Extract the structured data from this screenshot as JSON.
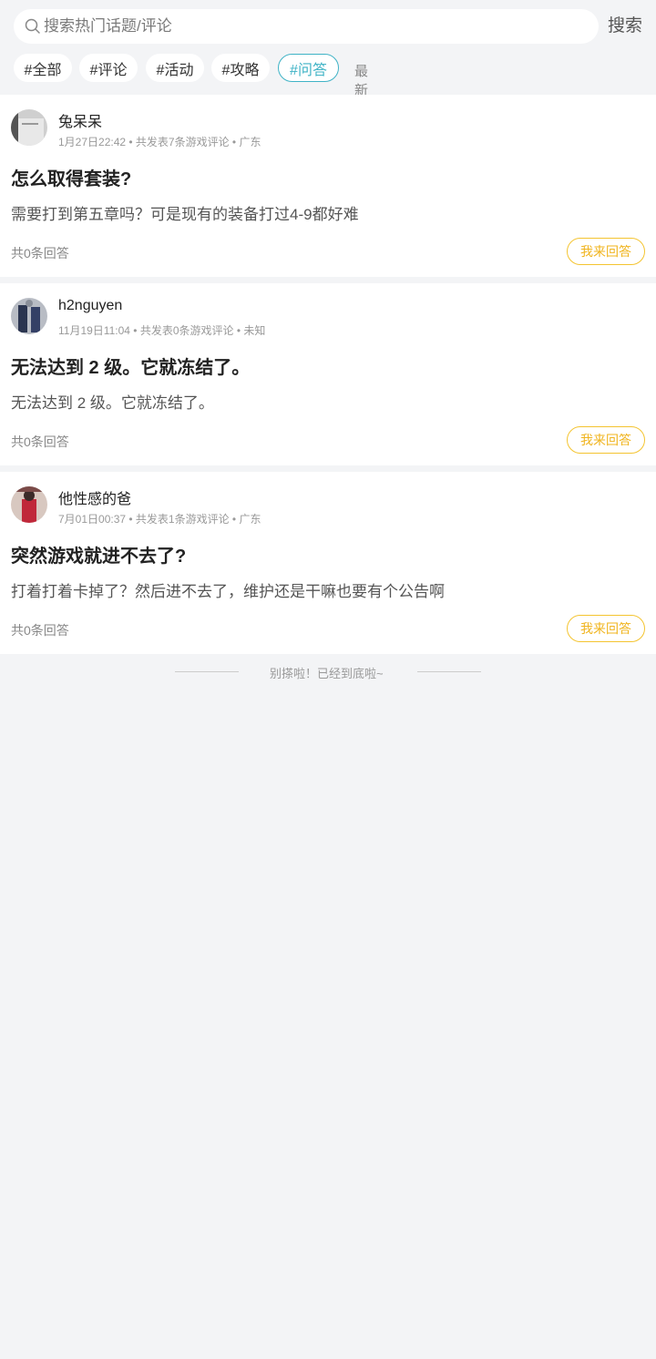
{
  "search": {
    "placeholder": "搜索热门话题/评论",
    "button_label": "搜索"
  },
  "tags": [
    {
      "label": "#全部",
      "active": false
    },
    {
      "label": "#评论",
      "active": false
    },
    {
      "label": "#活动",
      "active": false
    },
    {
      "label": "#攻略",
      "active": false
    },
    {
      "label": "#问答",
      "active": true
    }
  ],
  "sort": {
    "label": "最新帖子",
    "icon": "sort-arrows-icon"
  },
  "posts": [
    {
      "username": "兔呆呆",
      "meta": "1月27日22:42 • 共发表7条游戏评论 • 广东",
      "title": "怎么取得套装?",
      "content": "需要打到第五章吗？可是现有的装备打过4-9都好难",
      "answer_count": "共0条回答",
      "answer_label": "我来回答"
    },
    {
      "username": "h2nguyen",
      "meta": "11月19日11:04 • 共发表0条游戏评论 • 未知",
      "title": "无法达到 2 级。它就冻结了。",
      "content": "无法达到 2 级。它就冻结了。",
      "answer_count": "共0条回答",
      "answer_label": "我来回答"
    },
    {
      "username": "他性感的爸",
      "meta": "7月01日00:37 • 共发表1条游戏评论 • 广东",
      "title": "突然游戏就进不去了?",
      "content": "打着打着卡掉了？然后进不去了，维护还是干嘛也要有个公告啊",
      "answer_count": "共0条回答",
      "answer_label": "我来回答"
    }
  ],
  "footer": {
    "text": "别搽啦！已经到底啦~"
  },
  "colors": {
    "accent": "#3fb3c6",
    "answer": "#f0b41e",
    "background": "#f3f4f6"
  }
}
